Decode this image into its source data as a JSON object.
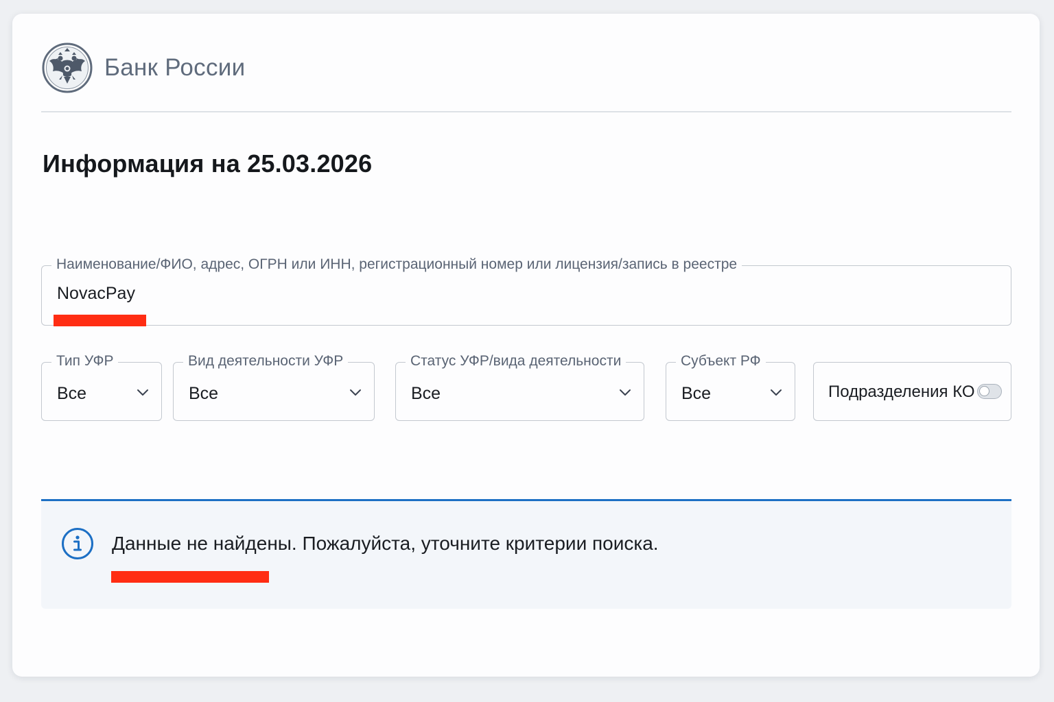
{
  "header": {
    "bank_name": "Банк России",
    "emblem_icon": "double-headed-eagle-emblem-icon"
  },
  "page": {
    "title": "Информация на 25.03.2026"
  },
  "search": {
    "label": "Наименование/ФИО, адрес, ОГРН или ИНН, регистрационный номер или лицензия/запись в реестре",
    "value": "NovacPay"
  },
  "filters": {
    "type": {
      "label": "Тип УФР",
      "value": "Все"
    },
    "activity": {
      "label": "Вид деятельности УФР",
      "value": "Все"
    },
    "status": {
      "label": "Статус УФР/вида деятельности",
      "value": "Все"
    },
    "region": {
      "label": "Субъект РФ",
      "value": "Все"
    },
    "subdivisions": {
      "label": "Подразделения КО",
      "enabled": false
    }
  },
  "alert": {
    "icon": "info-icon",
    "message": "Данные не найдены. Пожалуйста, уточните критерии поиска."
  },
  "colors": {
    "accent": "#1c6fc4",
    "highlight_mark": "#ff2d13",
    "brand_text": "#5f6b7c"
  }
}
